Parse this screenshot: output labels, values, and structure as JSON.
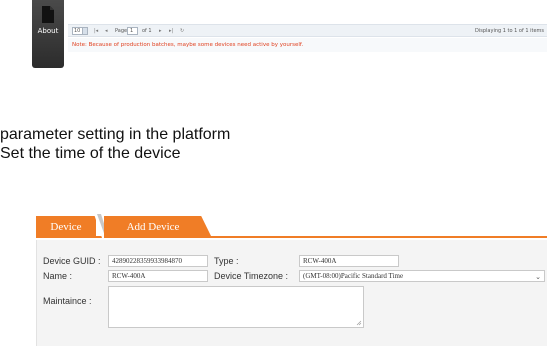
{
  "sidebar": {
    "about_label": "About",
    "icon": "document-icon"
  },
  "pager": {
    "page_size": "10",
    "page_label": "Page",
    "page_value": "1",
    "of_label": "of 1",
    "display_text": "Displaying 1 to 1 of 1 items"
  },
  "notice": "Note: Because of production batches, maybe some devices need active by yourself.",
  "headings": {
    "line1": "parameter setting in the platform",
    "line2": "Set the time of the device"
  },
  "tabs": [
    {
      "label": "Device"
    },
    {
      "label": "Add Device"
    }
  ],
  "form": {
    "guid_label": "Device GUID :",
    "guid_value": "42890228359933984870",
    "type_label": "Type :",
    "type_value": "RCW-400A",
    "name_label": "Name :",
    "name_value": "RCW-400A",
    "timezone_label": "Device Timezone :",
    "timezone_value": "(GMT-08:00)Pacific Standard Time",
    "maintaince_label": "Maintaince :",
    "maintaince_value": ""
  },
  "colors": {
    "accent": "#f07d26",
    "notice": "#e0401f",
    "sidebar": "#3a3a3a"
  }
}
